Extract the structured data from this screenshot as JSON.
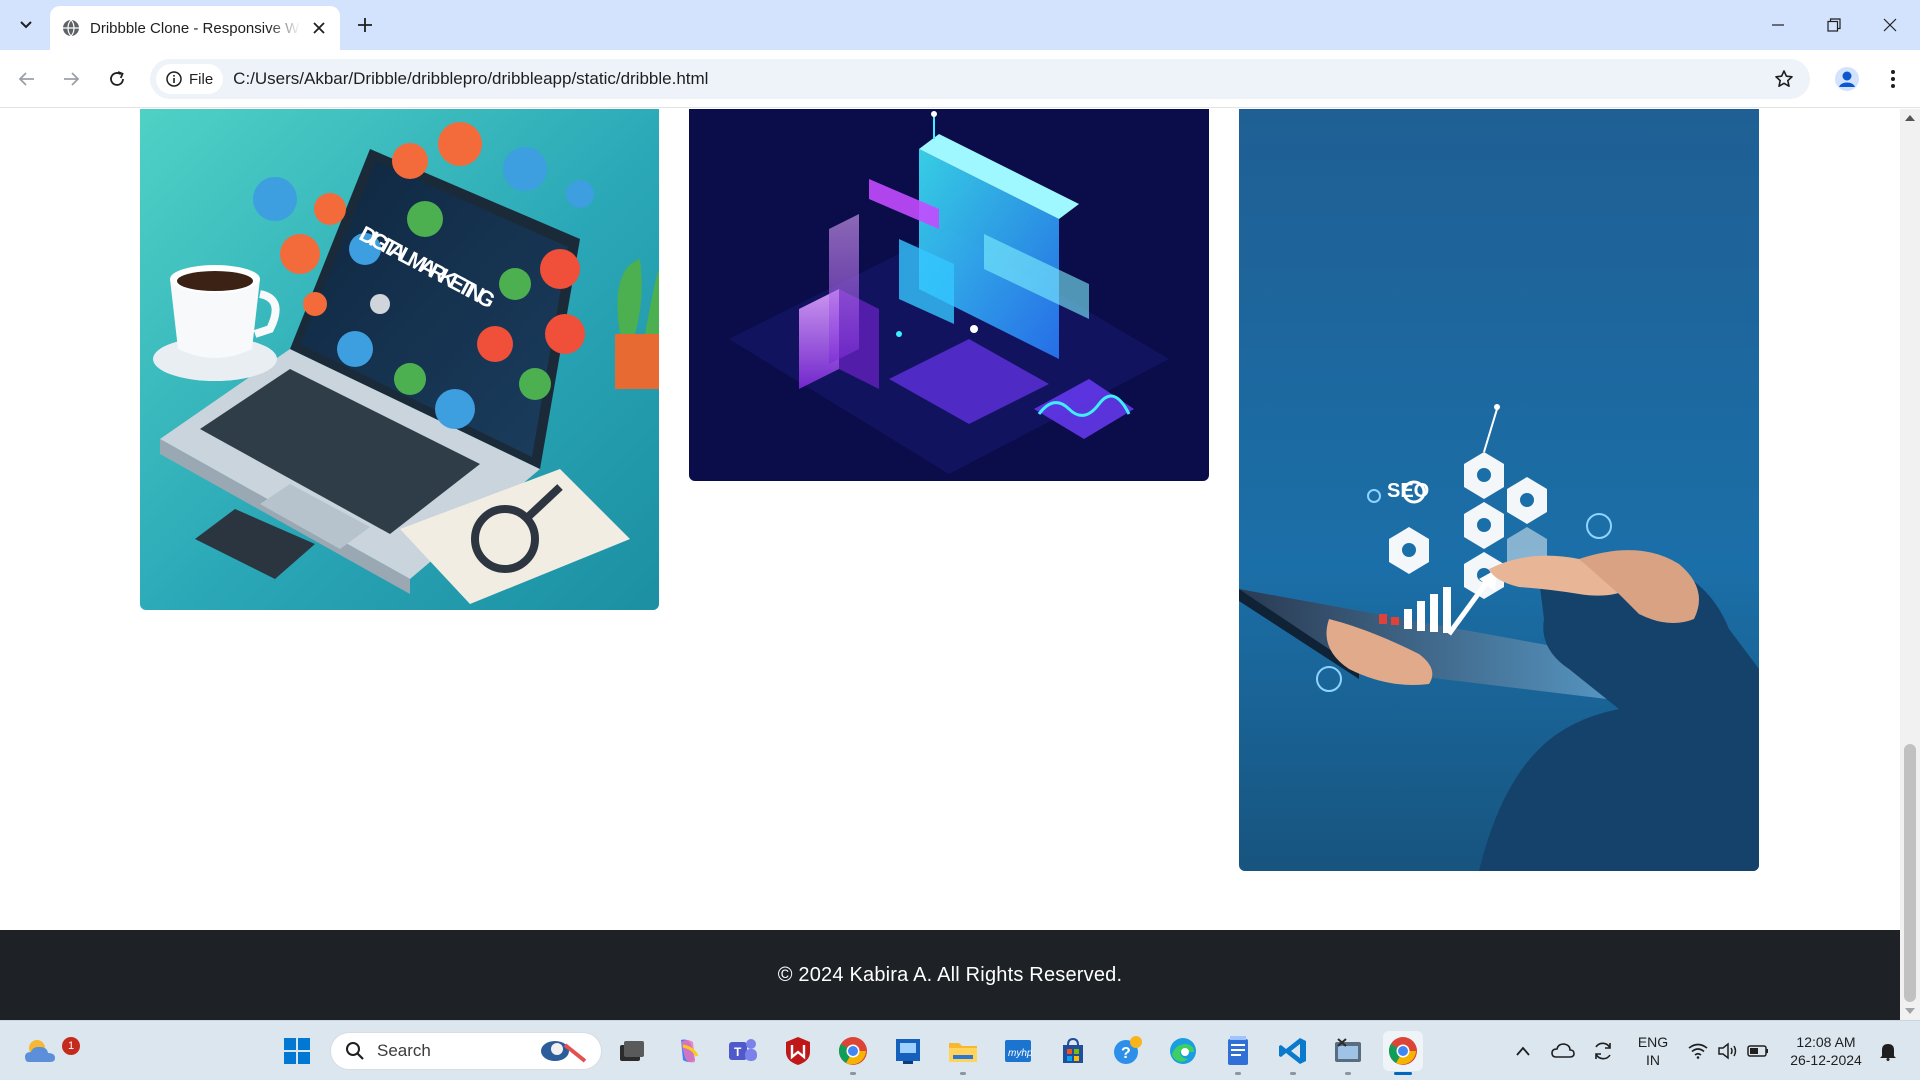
{
  "browser": {
    "tab": {
      "title": "Dribbble Clone - Responsive Website"
    },
    "chip_label": "File",
    "url": "C:/Users/Akbar/Dribble/dribblepro/dribbleapp/static/dribble.html"
  },
  "page": {
    "cards": [
      {
        "image": "digital-marketing-illustration",
        "text": "DIGITAL MARKETING"
      },
      {
        "image": "isometric-data-dashboard-illustration"
      },
      {
        "image": "seo-tablet-illustration",
        "text": "SEO"
      }
    ],
    "footer": {
      "text": "© 2024 Kabira A. All Rights Reserved."
    }
  },
  "taskbar": {
    "weather_badge": "1",
    "search_placeholder": "Search",
    "tray": {
      "language_top": "ENG",
      "language_bottom": "IN",
      "time": "12:08 AM",
      "date": "26-12-2024"
    },
    "pinned": [
      "task-view",
      "copilot",
      "teams",
      "mcafee",
      "chrome",
      "news",
      "file-explorer",
      "myhp",
      "microsoft-store",
      "help",
      "edge",
      "notepad",
      "vscode",
      "snipping-tool",
      "chrome-active"
    ]
  },
  "colors": {
    "tabbar": "#d3e3fd",
    "footer": "#1e2226",
    "taskbar": "#dbe6ef",
    "accent": "#0067c0"
  }
}
